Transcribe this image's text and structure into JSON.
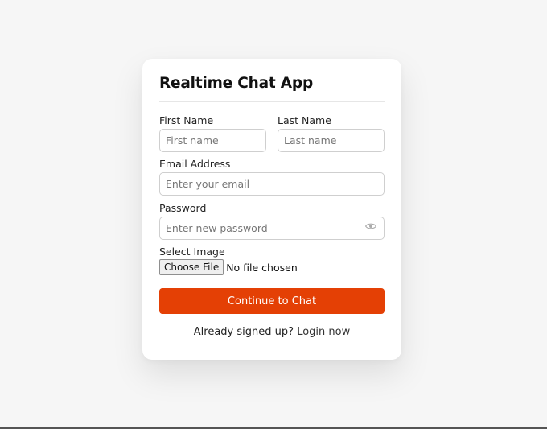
{
  "app": {
    "title": "Realtime Chat App"
  },
  "form": {
    "first_name": {
      "label": "First Name",
      "placeholder": "First name",
      "value": ""
    },
    "last_name": {
      "label": "Last Name",
      "placeholder": "Last name",
      "value": ""
    },
    "email": {
      "label": "Email Address",
      "placeholder": "Enter your email",
      "value": ""
    },
    "password": {
      "label": "Password",
      "placeholder": "Enter new password",
      "value": "",
      "toggle_icon": "eye-icon"
    },
    "image": {
      "label": "Select Image",
      "button_label": "Choose File",
      "status": "No file chosen"
    },
    "submit_label": "Continue to Chat"
  },
  "footer": {
    "prompt": "Already signed up?",
    "link": "Login now"
  },
  "colors": {
    "background": "#f6f6f6",
    "card": "#ffffff",
    "accent": "#e44005"
  }
}
